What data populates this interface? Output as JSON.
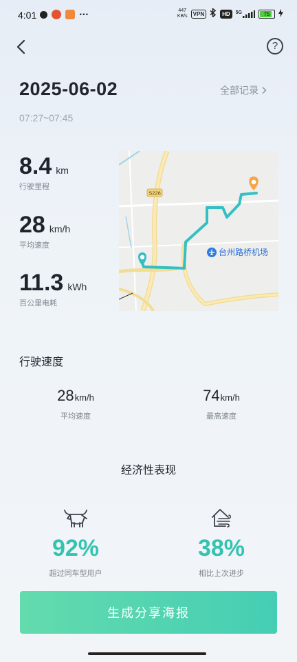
{
  "status_bar": {
    "time": "4:01",
    "net_speed_value": "447",
    "net_speed_unit": "KB/s",
    "vpn": "VPN",
    "hd": "HD",
    "signal": "5G",
    "battery": "75",
    "more": "···"
  },
  "header": {
    "date": "2025-06-02",
    "all_records": "全部记录",
    "time_range": "07:27~07:45",
    "help": "?"
  },
  "stats": [
    {
      "value": "8.4",
      "unit": "km",
      "label": "行驶里程"
    },
    {
      "value": "28",
      "unit": "km/h",
      "label": "平均速度"
    },
    {
      "value": "11.3",
      "unit": "kWh",
      "label": "百公里电耗"
    }
  ],
  "map": {
    "road_label": "S226",
    "poi_label": "台州路桥机场",
    "route_color": "#35bfc3",
    "end_color": "#f5a54a"
  },
  "driving_speed": {
    "title": "行驶速度",
    "items": [
      {
        "value": "28",
        "unit": "km/h",
        "label": "平均速度"
      },
      {
        "value": "74",
        "unit": "km/h",
        "label": "最高速度"
      }
    ]
  },
  "economy": {
    "title": "经济性表现",
    "items": [
      {
        "value": "92%",
        "label": "超过同车型用户",
        "icon": "bull-icon"
      },
      {
        "value": "38%",
        "label": "相比上次进步",
        "icon": "house-wind-icon"
      }
    ],
    "accent": "#35c3b0"
  },
  "action": {
    "generate_poster": "生成分享海报"
  }
}
